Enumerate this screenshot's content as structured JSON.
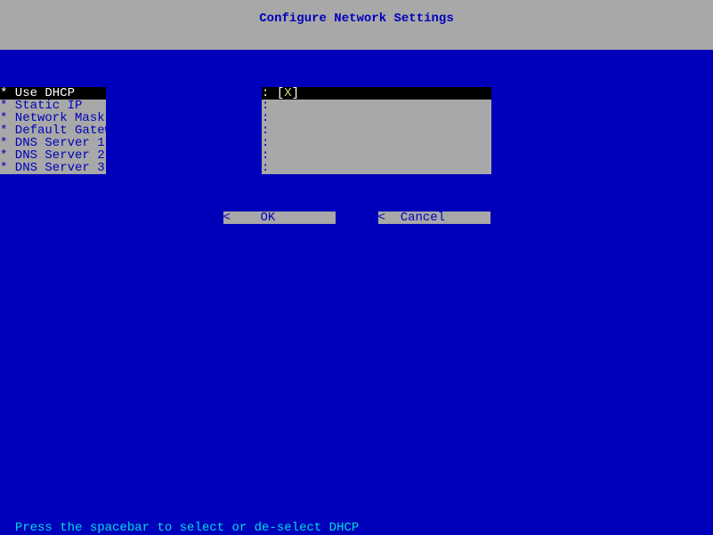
{
  "title": "Configure Network Settings",
  "labels": [
    {
      "text": "* Use DHCP",
      "selected": true
    },
    {
      "text": "* Static IP",
      "selected": false
    },
    {
      "text": "* Network Mask",
      "selected": false
    },
    {
      "text": "* Default Gateway",
      "selected": false
    },
    {
      "text": "* DNS Server 1",
      "selected": false
    },
    {
      "text": "* DNS Server 2",
      "selected": false
    },
    {
      "text": "* DNS Server 3",
      "selected": false
    }
  ],
  "values": [
    {
      "prefix": ": ",
      "content": "[X]",
      "selected": true
    },
    {
      "prefix": ":",
      "content": "",
      "selected": false
    },
    {
      "prefix": ":",
      "content": "",
      "selected": false
    },
    {
      "prefix": ":",
      "content": "",
      "selected": false
    },
    {
      "prefix": ":",
      "content": "",
      "selected": false
    },
    {
      "prefix": ":",
      "content": "",
      "selected": false
    },
    {
      "prefix": ":",
      "content": "",
      "selected": false
    }
  ],
  "buttons": {
    "ok": "<    OK        >",
    "cancel": "<  Cancel       >"
  },
  "status": "Press the spacebar to select or de-select DHCP"
}
